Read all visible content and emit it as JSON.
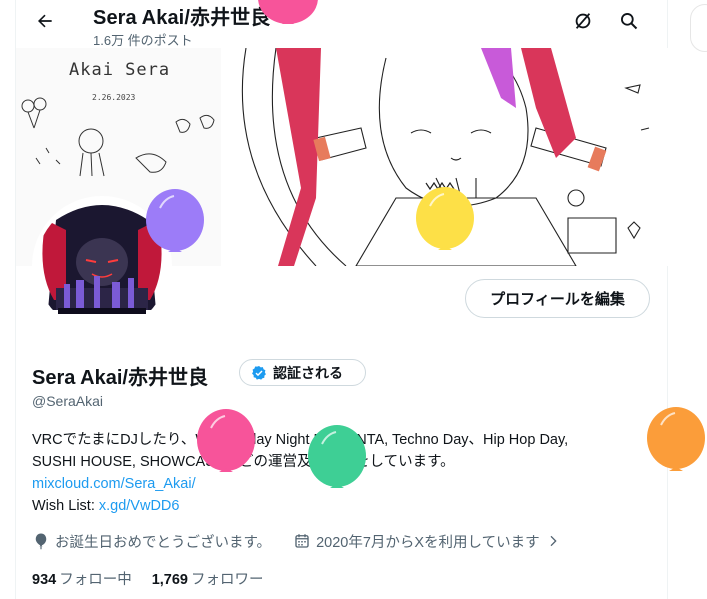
{
  "header": {
    "title": "Sera Akai/赤井世良",
    "post_count": "1.6万 件のポスト",
    "back_icon": "arrow-left-icon",
    "grok_icon": "grok-icon",
    "search_icon": "search-icon"
  },
  "banner": {
    "signature": "Akai Sera",
    "date": "2.26.2023"
  },
  "profile": {
    "edit_button": "プロフィールを編集",
    "name": "Sera Akai/赤井世良",
    "verified_label": "認証される",
    "handle": "@SeraAkai",
    "bio_line1": "VRCでたまにDJしたり、Wednesday Night MAGENTA, Techno Day、Hip Hop Day,",
    "bio_line2": "SUSHI HOUSE, SHOWCASEなどの運営及び協力をしています。",
    "link_url": "mixcloud.com/Sera_Akai/",
    "wishlist_label": "Wish List: ",
    "wishlist_url": "x.gd/VwDD6",
    "birthday_text": "お誕生日おめでとうございます。",
    "joined_text": "2020年7月からXを利用しています",
    "following_count": "934",
    "following_label": "フォロー中",
    "followers_count": "1,769",
    "followers_label": "フォロワー"
  },
  "colors": {
    "link": "#1d9bf0",
    "verified": "#1d9bf0",
    "secondary_text": "#536471",
    "balloon_pink": "#f7549a",
    "balloon_purple": "#9c7cf8",
    "balloon_yellow": "#fde047",
    "balloon_green": "#3ecf95",
    "balloon_orange": "#fb9d3a"
  }
}
